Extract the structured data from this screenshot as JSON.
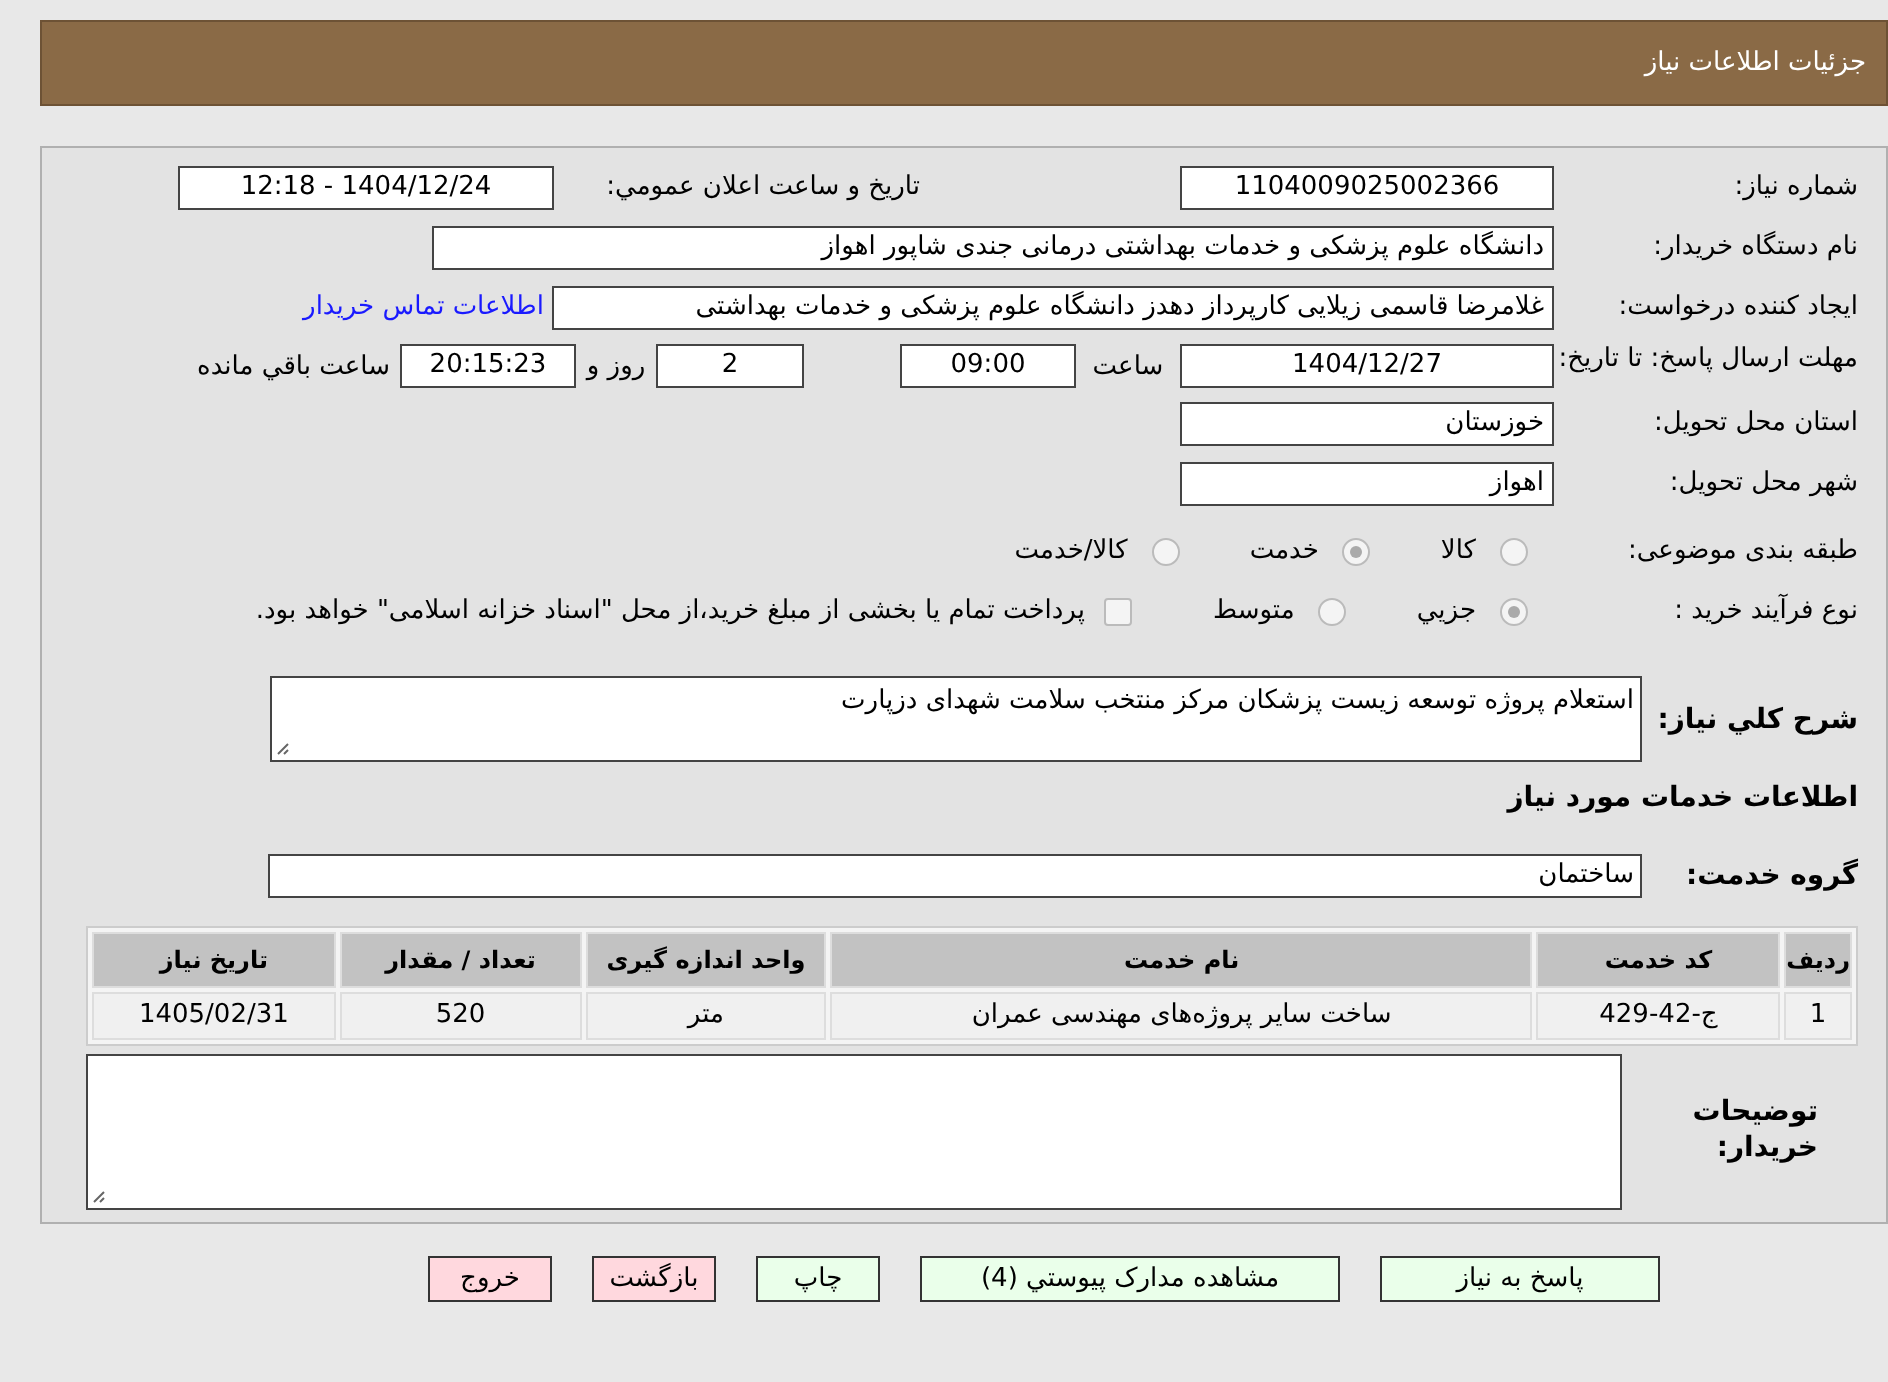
{
  "header": {
    "title": "جزئیات اطلاعات نیاز"
  },
  "fields": {
    "need_number": {
      "label": "شماره نیاز:",
      "value": "1104009025002366"
    },
    "announce": {
      "label": "تاریخ و ساعت اعلان عمومي:",
      "value": "1404/12/24 - 12:18"
    },
    "buyer_org": {
      "label": "نام دستگاه خریدار:",
      "value": "دانشگاه علوم پزشکی و خدمات بهداشتی درمانی جندی شاپور اهواز"
    },
    "requester": {
      "label": "ایجاد کننده درخواست:",
      "value": "غلامرضا قاسمی زیلایی کارپرداز دهدز دانشگاه علوم پزشکی و خدمات بهداشتی",
      "link": "اطلاعات تماس خریدار"
    },
    "deadline": {
      "label": "مهلت ارسال پاسخ: تا تاریخ:",
      "date": "1404/12/27",
      "time_label": "ساعت",
      "time": "09:00",
      "days": "2",
      "days_label": "روز و",
      "remaining": "20:15:23",
      "remaining_label": "ساعت باقي مانده"
    },
    "province": {
      "label": "استان محل تحویل:",
      "value": "خوزستان"
    },
    "city": {
      "label": "شهر محل تحویل:",
      "value": "اهواز"
    }
  },
  "category": {
    "label": "طبقه بندی موضوعی:",
    "options": [
      {
        "label": "کالا",
        "selected": false
      },
      {
        "label": "خدمت",
        "selected": true
      },
      {
        "label": "کالا/خدمت",
        "selected": false
      }
    ]
  },
  "process": {
    "label": "نوع فرآیند خرید :",
    "options": [
      {
        "label": "جزيي",
        "selected": true
      },
      {
        "label": "متوسط",
        "selected": false
      }
    ],
    "treasury": {
      "label": "پرداخت تمام یا بخشی از مبلغ خرید،از محل \"اسناد خزانه اسلامی\" خواهد بود.",
      "checked": false
    }
  },
  "description": {
    "label": "شرح کلي نیاز:",
    "value": "استعلام پروژه توسعه زیست پزشکان مرکز منتخب سلامت شهدای دزپارت"
  },
  "services_heading": "اطلاعات خدمات مورد نیاز",
  "service_group": {
    "label": "گروه خدمت:",
    "value": "ساختمان"
  },
  "table": {
    "columns": [
      "ردیف",
      "کد خدمت",
      "نام خدمت",
      "واحد اندازه گیری",
      "تعداد / مقدار",
      "تاریخ نیاز"
    ],
    "rows": [
      [
        "1",
        "ج-42-429",
        "ساخت سایر پروژه‌های مهندسی عمران",
        "متر",
        "520",
        "1405/02/31"
      ]
    ]
  },
  "buyer_notes": {
    "label": "توضیحات خریدار:"
  },
  "buttons": [
    {
      "label": "پاسخ به نیاز",
      "kind": "normal"
    },
    {
      "label": "مشاهده مدارک پیوستي (4)",
      "kind": "normal"
    },
    {
      "label": "چاپ",
      "kind": "normal"
    },
    {
      "label": "بازگشت",
      "kind": "danger"
    },
    {
      "label": "خروج",
      "kind": "danger"
    }
  ]
}
